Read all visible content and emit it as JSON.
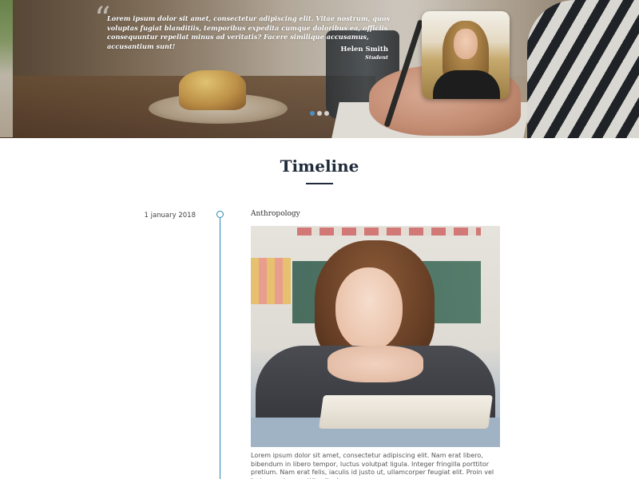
{
  "testimonial": {
    "quote": "Lorem ipsum dolor sit amet, consectetur adipiscing elit. Vitae nostrum, quos voluptas fugiat blanditiis, temporibus expedita cumque doloribus ea, officiis consequuntur repellat minus ad veritatis? Facere similique accusamus, accusantium sunt!",
    "author_name": "Helen Smith",
    "author_role": "Student",
    "quote_icon": "quote-icon",
    "slides": 3,
    "active_slide": 1
  },
  "timeline": {
    "title": "Timeline",
    "items": [
      {
        "date": "1 january 2018",
        "heading": "Anthropology",
        "body": "Lorem ipsum dolor sit amet, consectetur adipiscing elit. Nam erat libero, bibendum in libero tempor, luctus volutpat ligula. Integer fringilla porttitor pretium. Nam erat felis, iaculis id justo ut, ullamcorper feugiat elit. Proin vel lectus auctor, porttitor ligula"
      }
    ]
  },
  "colors": {
    "accent": "#2b86b8",
    "title": "#1f2a3a",
    "active_dot": "#4a8fc0"
  }
}
